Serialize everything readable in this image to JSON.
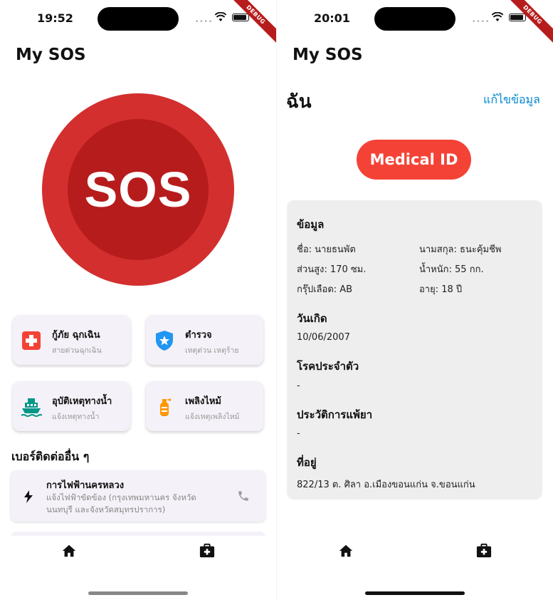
{
  "left": {
    "status": {
      "time": "19:52",
      "debug": "DEBUG"
    },
    "app_title": "My SOS",
    "sos_label": "SOS",
    "cards": [
      {
        "title": "กู้ภัย ฉุกเฉิน",
        "subtitle": "สายด่วนฉุกเฉิน",
        "icon": "medical-cross-icon",
        "color": "#f44336"
      },
      {
        "title": "ตำรวจ",
        "subtitle": "เหตุด่วน เหตุร้าย",
        "icon": "police-badge-icon",
        "color": "#2196f3"
      },
      {
        "title": "อุบัติเหตุทางน้ำ",
        "subtitle": "แจ้งเหตุทางน้ำ",
        "icon": "boat-icon",
        "color": "#009688"
      },
      {
        "title": "เพลิงไหม้",
        "subtitle": "แจ้งเหตุเพลิงไหม้",
        "icon": "fire-extinguisher-icon",
        "color": "#ff9800"
      }
    ],
    "other_numbers_heading": "เบอร์ติดต่ออื่น ๆ",
    "list_items": [
      {
        "title": "การไฟฟ้านครหลวง",
        "subtitle": "แจ้งไฟฟ้าขัดข้อง (กรุงเทพมหานคร จังหวัดนนทบุรี และจังหวัดสมุทรปราการ)"
      }
    ]
  },
  "right": {
    "status": {
      "time": "20:01",
      "debug": "DEBUG"
    },
    "app_title": "My SOS",
    "me_title": "ฉัน",
    "edit_link": "แก้ไขข้อมูล",
    "medical_id_button": "Medical ID",
    "info": {
      "section_title": "ข้อมูล",
      "first_name": "ชื่อ: นายธนพัต",
      "last_name": "นามสกุล: ธนะคุ้มชีพ",
      "height": "ส่วนสูง: 170 ซม.",
      "weight": "น้ำหนัก: 55 กก.",
      "blood_type": "กรุ๊ปเลือด: AB",
      "age": "อายุ: 18 ปี",
      "birthday_title": "วันเกิด",
      "birthday": "10/06/2007",
      "disease_title": "โรคประจำตัว",
      "disease": "-",
      "allergy_title": "ประวัติการแพ้ยา",
      "allergy": "-",
      "address_title": "ที่อยู่",
      "address": "822/13 ต. ศิลา อ.เมืองขอนแก่น จ.ขอนแก่น"
    }
  },
  "nav": {
    "home_icon": "home-icon",
    "medical_icon": "medical-kit-icon"
  }
}
